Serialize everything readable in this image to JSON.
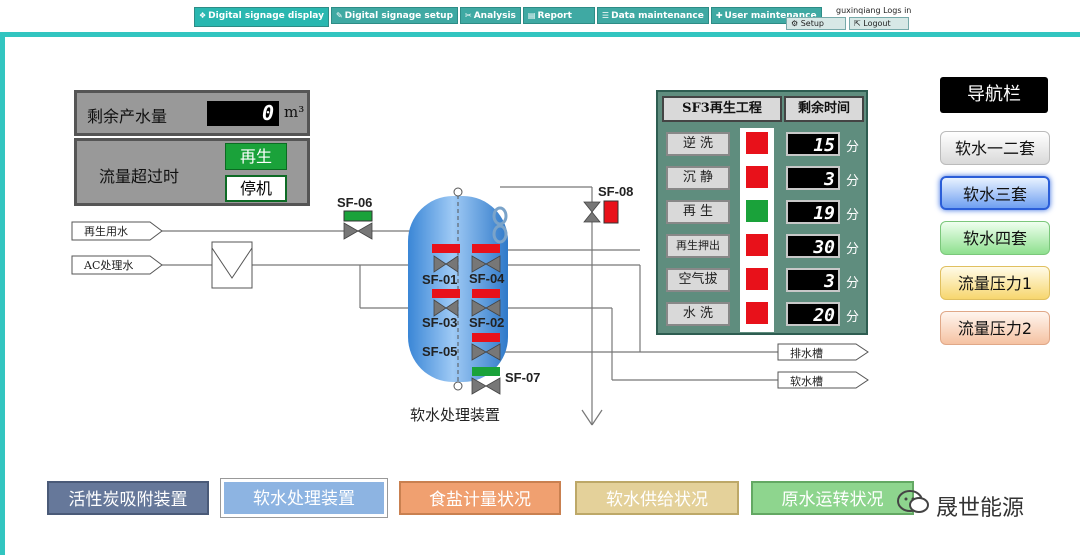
{
  "topnav": {
    "tabs": [
      {
        "icon": "❖",
        "label": "Digital signage display"
      },
      {
        "icon": "✎",
        "label": "Digital signage setup"
      },
      {
        "icon": "✂",
        "label": "Analysis"
      },
      {
        "icon": "▤",
        "label": "Report"
      },
      {
        "icon": "☰",
        "label": "Data maintenance"
      },
      {
        "icon": "✚",
        "label": "User maintenance"
      }
    ],
    "user_line": "guxinqiang  Logs in",
    "setup_label": "Setup",
    "logout_label": "Logout"
  },
  "water_panel": {
    "label": "剩余产水量",
    "value": "0",
    "unit": "m³"
  },
  "flow_panel": {
    "label": "流量超过时",
    "regen_label": "再生",
    "stop_label": "停机"
  },
  "sf_table": {
    "header_left": "SF3再生工程",
    "header_right": "剩余时间",
    "unit": "分",
    "steps": [
      {
        "name": "逆 洗",
        "status": "red",
        "minutes": "15"
      },
      {
        "name": "沉 静",
        "status": "red",
        "minutes": "3"
      },
      {
        "name": "再 生",
        "status": "green",
        "minutes": "19"
      },
      {
        "name": "再生押出",
        "status": "red",
        "minutes": "30"
      },
      {
        "name": "空气拔",
        "status": "red",
        "minutes": "3"
      },
      {
        "name": "水 洗",
        "status": "red",
        "minutes": "20"
      }
    ]
  },
  "diagram": {
    "inlet_regen": "再生用水",
    "inlet_ac": "AC处理水",
    "outlet_drain": "排水槽",
    "outlet_soft": "软水槽",
    "device_label": "软水处理装置",
    "valves": [
      "SF-06",
      "SF-08",
      "SF-01",
      "SF-04",
      "SF-03",
      "SF-02",
      "SF-05",
      "SF-07"
    ]
  },
  "sidenav": {
    "title": "导航栏",
    "items": [
      "软水一二套",
      "软水三套",
      "软水四套",
      "流量压力1",
      "流量压力2"
    ]
  },
  "bottom": {
    "buttons": [
      "活性炭吸附装置",
      "软水处理装置",
      "食盐计量状况",
      "软水供给状况",
      "原水运转状况"
    ]
  },
  "watermark": "晟世能源",
  "colors": {
    "accent": "#32c5c0",
    "red": "#e8111a",
    "green": "#1aa23a"
  }
}
